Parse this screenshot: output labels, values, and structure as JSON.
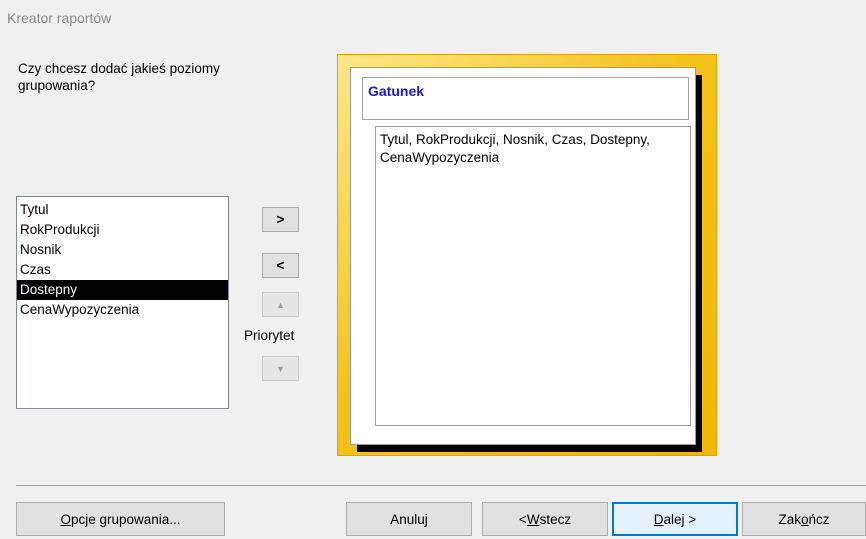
{
  "window": {
    "title": "Kreator raportów"
  },
  "question": "Czy chcesz dodać jakieś poziomy grupowania?",
  "fields": [
    {
      "label": "Tytul",
      "selected": false
    },
    {
      "label": "RokProdukcji",
      "selected": false
    },
    {
      "label": "Nosnik",
      "selected": false
    },
    {
      "label": "Czas",
      "selected": false
    },
    {
      "label": "Dostepny",
      "selected": true
    },
    {
      "label": "CenaWypozyczenia",
      "selected": false
    }
  ],
  "move_buttons": {
    "add": ">",
    "remove": "<",
    "priority_up_icon": "arrow-up-icon",
    "priority_down_icon": "arrow-down-icon"
  },
  "priority_label": "Priorytet",
  "preview": {
    "group_field": "Gatunek",
    "detail_fields": "Tytul, RokProdukcji, Nosnik, Czas, Dostepny, CenaWypozyczenia"
  },
  "buttons": {
    "grouping_options": {
      "pre": "",
      "accel": "O",
      "post": "pcje grupowania..."
    },
    "cancel": "Anuluj",
    "back": {
      "pre": "< ",
      "accel": "W",
      "post": "stecz"
    },
    "next": {
      "pre": "",
      "accel": "D",
      "post": "alej >"
    },
    "finish": {
      "pre": "Zak",
      "accel": "o",
      "post": "ńcz"
    }
  },
  "colors": {
    "selection_bg": "#000000",
    "group_header_text": "#1c17d4",
    "preview_frame": "#f4c21c",
    "default_button_border": "#0078d7"
  }
}
